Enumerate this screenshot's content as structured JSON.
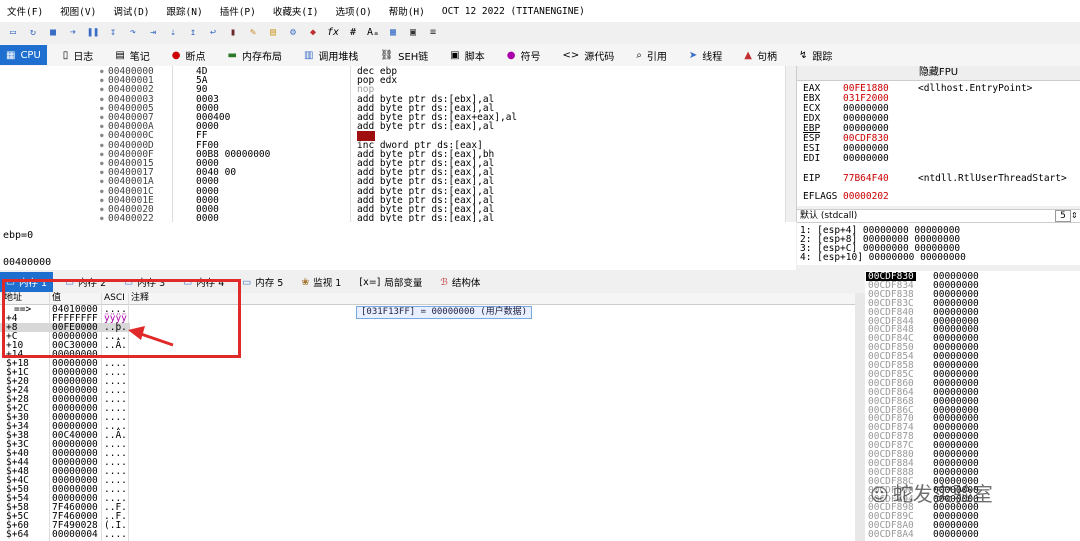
{
  "menu": [
    "文件(F)",
    "视图(V)",
    "调试(D)",
    "跟踪(N)",
    "插件(P)",
    "收藏夹(I)",
    "选项(O)",
    "帮助(H)",
    "OCT 12 2022 (TITANENGINE)"
  ],
  "toolbar_icons": [
    "open-icon",
    "restart-icon",
    "close-icon",
    "run-icon",
    "pause-icon",
    "step-into-icon",
    "step-over-icon",
    "trace-into-icon",
    "trace-over-icon",
    "execute-till-return-icon",
    "run-to-user-icon",
    "animate-icon",
    "pen-icon",
    "note-icon",
    "pattern-icon",
    "patch-icon",
    "fx-icon",
    "hash-icon",
    "font-icon",
    "hexdump-icon",
    "calc-icon",
    "settings-icon"
  ],
  "tabs": [
    {
      "label": "CPU",
      "icon": "cpu-icon",
      "active": true
    },
    {
      "label": "日志",
      "icon": "log-icon"
    },
    {
      "label": "笔记",
      "icon": "notes-icon"
    },
    {
      "label": "断点",
      "icon": "breakpoint-icon"
    },
    {
      "label": "内存布局",
      "icon": "memory-map-icon"
    },
    {
      "label": "调用堆栈",
      "icon": "callstack-icon"
    },
    {
      "label": "SEH链",
      "icon": "seh-icon"
    },
    {
      "label": "脚本",
      "icon": "script-icon"
    },
    {
      "label": "符号",
      "icon": "symbols-icon"
    },
    {
      "label": "源代码",
      "icon": "source-icon"
    },
    {
      "label": "引用",
      "icon": "references-icon"
    },
    {
      "label": "线程",
      "icon": "threads-icon"
    },
    {
      "label": "句柄",
      "icon": "handles-icon"
    },
    {
      "label": "跟踪",
      "icon": "trace-icon"
    }
  ],
  "disasm": [
    {
      "addr": "00400000",
      "bytes": "4D",
      "instr": "dec ebp"
    },
    {
      "addr": "00400001",
      "bytes": "5A",
      "instr": "pop edx"
    },
    {
      "addr": "00400002",
      "bytes": "90",
      "instr": "nop"
    },
    {
      "addr": "00400003",
      "bytes": "0003",
      "instr": "add byte ptr ds:[ebx],al"
    },
    {
      "addr": "00400005",
      "bytes": "0000",
      "instr": "add byte ptr ds:[eax],al"
    },
    {
      "addr": "00400007",
      "bytes": "000400",
      "instr": "add byte ptr ds:[eax+eax],al"
    },
    {
      "addr": "0040000A",
      "bytes": "0000",
      "instr": "add byte ptr ds:[eax],al"
    },
    {
      "addr": "0040000C",
      "bytes": "FF",
      "instr": "???"
    },
    {
      "addr": "0040000D",
      "bytes": "FF00",
      "instr": "inc dword ptr ds:[eax]"
    },
    {
      "addr": "0040000F",
      "bytes": "00B8 00000000",
      "instr": "add byte ptr ds:[eax],bh"
    },
    {
      "addr": "00400015",
      "bytes": "0000",
      "instr": "add byte ptr ds:[eax],al"
    },
    {
      "addr": "00400017",
      "bytes": "0040 00",
      "instr": "add byte ptr ds:[eax],al"
    },
    {
      "addr": "0040001A",
      "bytes": "0000",
      "instr": "add byte ptr ds:[eax],al"
    },
    {
      "addr": "0040001C",
      "bytes": "0000",
      "instr": "add byte ptr ds:[eax],al"
    },
    {
      "addr": "0040001E",
      "bytes": "0000",
      "instr": "add byte ptr ds:[eax],al"
    },
    {
      "addr": "00400020",
      "bytes": "0000",
      "instr": "add byte ptr ds:[eax],al"
    },
    {
      "addr": "00400022",
      "bytes": "0000",
      "instr": "add byte ptr ds:[eax],al"
    }
  ],
  "fpu": {
    "header": "隐藏FPU",
    "regs": [
      {
        "name": "EAX",
        "val": "00FE1880",
        "comment": "<dllhost.EntryPoint>",
        "red": true
      },
      {
        "name": "EBX",
        "val": "031F2000",
        "comment": "",
        "red": true
      },
      {
        "name": "ECX",
        "val": "00000000",
        "comment": "",
        "red": false
      },
      {
        "name": "EDX",
        "val": "00000000",
        "comment": "",
        "red": false
      },
      {
        "name": "EBP",
        "val": "00000000",
        "comment": "",
        "red": false
      },
      {
        "name": "ESP",
        "val": "00CDF830",
        "comment": "",
        "red": true
      },
      {
        "name": "ESI",
        "val": "00000000",
        "comment": "",
        "red": false
      },
      {
        "name": "EDI",
        "val": "00000000",
        "comment": "",
        "red": false
      },
      {
        "name": "EIP",
        "val": "77B64F40",
        "comment": "<ntdll.RtlUserThreadStart>",
        "red": true
      },
      {
        "name": "EFLAGS",
        "val": "00000202",
        "comment": "",
        "red": true
      }
    ]
  },
  "callconv": {
    "label": "默认 (stdcall)",
    "count": "5"
  },
  "stackargs": [
    "1: [esp+4] 00000000 00000000",
    "2: [esp+8] 00000000 00000000",
    "3: [esp+C] 00000000 00000000",
    "4: [esp+10] 00000000 00000000"
  ],
  "info": {
    "line1": "ebp=0",
    "line2": "00400000"
  },
  "dumptabs": [
    {
      "label": "内存 1",
      "icon": "dump-icon",
      "active": true
    },
    {
      "label": "内存 2",
      "icon": "dump-icon"
    },
    {
      "label": "内存 3",
      "icon": "dump-icon"
    },
    {
      "label": "内存 4",
      "icon": "dump-icon"
    },
    {
      "label": "内存 5",
      "icon": "dump-icon"
    },
    {
      "label": "监视 1",
      "icon": "watch-icon"
    },
    {
      "label": "局部变量",
      "icon": "locals-icon"
    },
    {
      "label": "结构体",
      "icon": "struct-icon"
    }
  ],
  "dumphdr": {
    "addr": "地址",
    "val": "值",
    "ascii": "ASCI",
    "comment": "注释"
  },
  "dump": [
    {
      "a": "==>",
      "v": "04010000",
      "s": "...."
    },
    {
      "a": "+4",
      "v": "FFFFFFFF",
      "s": "ÿÿÿÿ"
    },
    {
      "a": "+8",
      "v": "00FE0000",
      "s": "..þ."
    },
    {
      "a": "+C",
      "v": "00000000",
      "s": "...."
    },
    {
      "a": "+10",
      "v": "00C30000",
      "s": "..Ã."
    },
    {
      "a": "+14",
      "v": "00000000",
      "s": "...."
    },
    {
      "a": "$+18",
      "v": "00000000",
      "s": "...."
    },
    {
      "a": "$+1C",
      "v": "00000000",
      "s": "...."
    },
    {
      "a": "$+20",
      "v": "00000000",
      "s": "...."
    },
    {
      "a": "$+24",
      "v": "00000000",
      "s": "...."
    },
    {
      "a": "$+28",
      "v": "00000000",
      "s": "...."
    },
    {
      "a": "$+2C",
      "v": "00000000",
      "s": "...."
    },
    {
      "a": "$+30",
      "v": "00000000",
      "s": "...."
    },
    {
      "a": "$+34",
      "v": "00000000",
      "s": "...."
    },
    {
      "a": "$+38",
      "v": "00C40000",
      "s": "..Ä."
    },
    {
      "a": "$+3C",
      "v": "00000000",
      "s": "...."
    },
    {
      "a": "$+40",
      "v": "00000000",
      "s": "...."
    },
    {
      "a": "$+44",
      "v": "00000000",
      "s": "...."
    },
    {
      "a": "$+48",
      "v": "00000000",
      "s": "...."
    },
    {
      "a": "$+4C",
      "v": "00000000",
      "s": "...."
    },
    {
      "a": "$+50",
      "v": "00000000",
      "s": "...."
    },
    {
      "a": "$+54",
      "v": "00000000",
      "s": "...."
    },
    {
      "a": "$+58",
      "v": "7F460000",
      "s": "..F."
    },
    {
      "a": "$+5C",
      "v": "7F460000",
      "s": "..F."
    },
    {
      "a": "$+60",
      "v": "7F490028",
      "s": "(.I."
    },
    {
      "a": "$+64",
      "v": "00000004",
      "s": "...."
    }
  ],
  "tooltip": "[031F13FF] = 00000000 (用户数据)",
  "stack": [
    {
      "a": "00CDF830",
      "v": "00000000"
    },
    {
      "a": "00CDF834",
      "v": "00000000"
    },
    {
      "a": "00CDF838",
      "v": "00000000"
    },
    {
      "a": "00CDF83C",
      "v": "00000000"
    },
    {
      "a": "00CDF840",
      "v": "00000000"
    },
    {
      "a": "00CDF844",
      "v": "00000000"
    },
    {
      "a": "00CDF848",
      "v": "00000000"
    },
    {
      "a": "00CDF84C",
      "v": "00000000"
    },
    {
      "a": "00CDF850",
      "v": "00000000"
    },
    {
      "a": "00CDF854",
      "v": "00000000"
    },
    {
      "a": "00CDF858",
      "v": "00000000"
    },
    {
      "a": "00CDF85C",
      "v": "00000000"
    },
    {
      "a": "00CDF860",
      "v": "00000000"
    },
    {
      "a": "00CDF864",
      "v": "00000000"
    },
    {
      "a": "00CDF868",
      "v": "00000000"
    },
    {
      "a": "00CDF86C",
      "v": "00000000"
    },
    {
      "a": "00CDF870",
      "v": "00000000"
    },
    {
      "a": "00CDF874",
      "v": "00000000"
    },
    {
      "a": "00CDF878",
      "v": "00000000"
    },
    {
      "a": "00CDF87C",
      "v": "00000000"
    },
    {
      "a": "00CDF880",
      "v": "00000000"
    },
    {
      "a": "00CDF884",
      "v": "00000000"
    },
    {
      "a": "00CDF888",
      "v": "00000000"
    },
    {
      "a": "00CDF88C",
      "v": "00000000"
    },
    {
      "a": "00CDF890",
      "v": "00000000"
    },
    {
      "a": "00CDF894",
      "v": "00000000"
    },
    {
      "a": "00CDF898",
      "v": "00000000"
    },
    {
      "a": "00CDF89C",
      "v": "00000000"
    },
    {
      "a": "00CDF8A0",
      "v": "00000000"
    },
    {
      "a": "00CDF8A4",
      "v": "00000000"
    }
  ],
  "watermark": "蛇发实验室"
}
